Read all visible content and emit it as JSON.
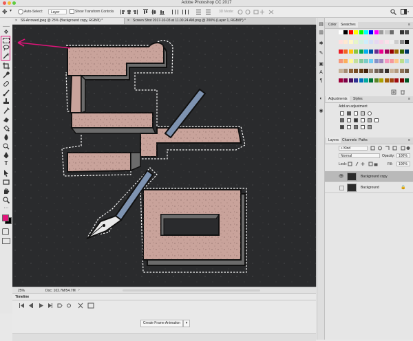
{
  "window": {
    "title": "Adobe Photoshop CC 2017"
  },
  "options_bar": {
    "auto_select_label": "Auto-Select:",
    "auto_select_value": "Layer",
    "show_transform_label": "Show Transform Controls",
    "mode_3d_label": "3D Mode:"
  },
  "tabs": [
    {
      "label": "S6-Arrowed.jpeg @ 25% (Background copy, RGB/8) *",
      "active": true
    },
    {
      "label": "Screen Shot 2017-10-03 at 11.00.24 AM.png @ 200% (Layer 1, RGB/8*) *",
      "active": false
    }
  ],
  "status": {
    "zoom": "25%",
    "doc": "Doc: 102.7M/54.7M"
  },
  "timeline": {
    "title": "Timeline",
    "create_button": "Create Frame Animation"
  },
  "panels": {
    "color_tab": "Color",
    "swatches_tab": "Swatches",
    "adjustments_tab": "Adjustments",
    "styles_tab": "Styles",
    "add_adjustment": "Add an adjustment",
    "layers_tab": "Layers",
    "channels_tab": "Channels",
    "paths_tab": "Paths",
    "kind_label": "Kind",
    "blend_mode": "Normal",
    "opacity_label": "Opacity:",
    "opacity_value": "100%",
    "lock_label": "Lock:",
    "fill_label": "Fill:",
    "fill_value": "100%",
    "layers": [
      {
        "name": "Background copy",
        "selected": true,
        "visible": true
      },
      {
        "name": "Background",
        "selected": false,
        "visible": false,
        "locked": true
      }
    ]
  },
  "colors": {
    "accent_highlight": "#e0147a",
    "foreground_swatch": "#e0147a",
    "background_swatch": "#000000",
    "canvas_bg": "#2a2b2d",
    "letter_fill": "#c9a39b",
    "letter_shadow": "#6b6b6b",
    "pen_blue": "#7e93b1"
  },
  "swatches": [
    "#ffffff",
    "#000000",
    "#ff0000",
    "#ffff00",
    "#00ff00",
    "#00ffff",
    "#0000ff",
    "#ff00ff",
    "#9a9a9a",
    "#c8c8c8",
    "#6b6b6b",
    "#e6e6e6",
    "#333333",
    "#4d4d4d",
    "#ffdede",
    "#ffe8d0",
    "#fff7c9",
    "#e6f5c8",
    "#d2f1e2",
    "#cdeefb",
    "#d7e0f6",
    "#e6d7f1",
    "#f7d4e8",
    "#fbe0ea",
    "#eeeeee",
    "#cccccc",
    "#888888",
    "#111111",
    "#ed1c24",
    "#f26522",
    "#ffc20e",
    "#8dc63f",
    "#00a651",
    "#00aeef",
    "#0054a6",
    "#662d91",
    "#ec008c",
    "#a3005e",
    "#990000",
    "#996600",
    "#336600",
    "#003366",
    "#f7977a",
    "#fbaf5d",
    "#fff79a",
    "#c4df9b",
    "#82ca9c",
    "#7accc8",
    "#6dcff6",
    "#8493ca",
    "#a187be",
    "#f49ac2",
    "#f6989d",
    "#fdc689",
    "#bcdf8a",
    "#a8d8e8",
    "#c6b299",
    "#a58c73",
    "#8c6239",
    "#754c24",
    "#603913",
    "#42210b",
    "#998675",
    "#736357",
    "#534741",
    "#362f2d",
    "#c7b299",
    "#b39a7e",
    "#8c7157",
    "#6b5844",
    "#9e0039",
    "#7b0046",
    "#440e62",
    "#2e3192",
    "#0072bc",
    "#00a99d",
    "#007236",
    "#598527",
    "#aba000",
    "#a36209",
    "#a0410d",
    "#9e0b0f",
    "#790000",
    "#005826"
  ]
}
